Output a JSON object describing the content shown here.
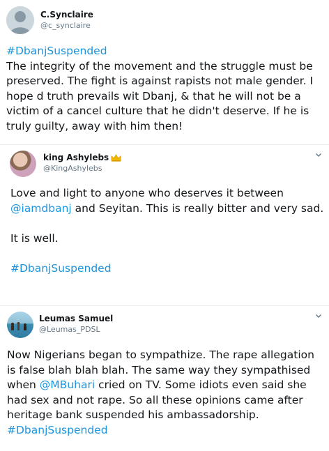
{
  "tweets": [
    {
      "user": {
        "name": "C.Synclaire",
        "handle": "@c_synclaire"
      },
      "body": {
        "hashtag": "#DbanjSuspended",
        "text": "The integrity of the movement and the struggle must be preserved. The fight is against rapists not male gender. I hope d truth prevails wit Dbanj, & that he will not be a victim of a cancel culture that he didn't deserve. If he is truly guilty, away with him then!"
      }
    },
    {
      "user": {
        "name": "king Ashylebs",
        "handle": "@KingAshylebs",
        "badge_icon": "crown-icon"
      },
      "body": {
        "p1_a": "Love and light to anyone who deserves it between ",
        "p1_mention": "@iamdbanj",
        "p1_b": " and Seyitan. This is really bitter and very sad.",
        "p2": "It is well.",
        "hashtag": "#DbanjSuspended"
      }
    },
    {
      "user": {
        "name": "Leumas Samuel",
        "handle": "@Leumas_PDSL"
      },
      "body": {
        "text_a": "Now Nigerians began to sympathize. The rape allegation is false blah blah blah. The same way they sympathised when ",
        "mention": "@MBuhari",
        "text_b": " cried on TV. Some idiots even said she had sex and not rape. So all these opinions came after heritage bank suspended his ambassadorship.  ",
        "hashtag": "#DbanjSuspended"
      }
    }
  ],
  "colors": {
    "link": "#1b95e0",
    "text": "#14171a",
    "secondary": "#657786",
    "divider": "#e6ecf0"
  }
}
